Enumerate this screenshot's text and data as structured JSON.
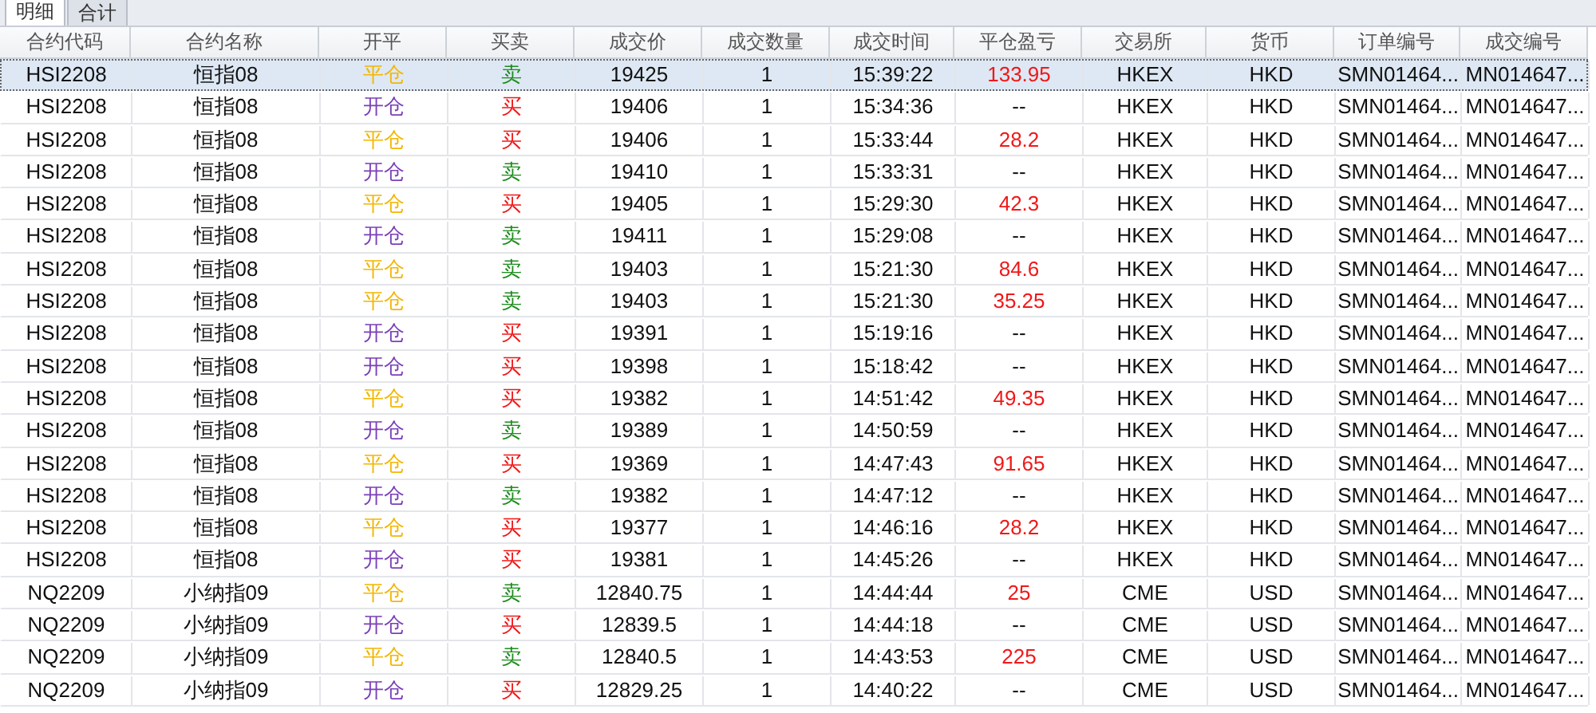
{
  "tabs": [
    {
      "label": "明细",
      "selected": true
    },
    {
      "label": "合计",
      "selected": false
    }
  ],
  "table": {
    "columns": [
      "合约代码",
      "合约名称",
      "开平",
      "买卖",
      "成交价",
      "成交数量",
      "成交时间",
      "平仓盈亏",
      "交易所",
      "货币",
      "订单编号",
      "成交编号"
    ],
    "rows": [
      {
        "selected": true,
        "cells": [
          "HSI2208",
          "恒指08",
          {
            "text": "平仓",
            "color": "#f2b705"
          },
          {
            "text": "卖",
            "color": "#1e8c1e"
          },
          "19425",
          "1",
          "15:39:22",
          {
            "text": "133.95",
            "color": "#f01818"
          },
          "HKEX",
          "HKD",
          "SMN01464...",
          "MN014647..."
        ]
      },
      {
        "selected": false,
        "cells": [
          "HSI2208",
          "恒指08",
          {
            "text": "开仓",
            "color": "#7b3fb8"
          },
          {
            "text": "买",
            "color": "#f01818"
          },
          "19406",
          "1",
          "15:34:36",
          {
            "text": "--",
            "color": "#111111"
          },
          "HKEX",
          "HKD",
          "SMN01464...",
          "MN014647..."
        ]
      },
      {
        "selected": false,
        "cells": [
          "HSI2208",
          "恒指08",
          {
            "text": "平仓",
            "color": "#f2b705"
          },
          {
            "text": "买",
            "color": "#f01818"
          },
          "19406",
          "1",
          "15:33:44",
          {
            "text": "28.2",
            "color": "#f01818"
          },
          "HKEX",
          "HKD",
          "SMN01464...",
          "MN014647..."
        ]
      },
      {
        "selected": false,
        "cells": [
          "HSI2208",
          "恒指08",
          {
            "text": "开仓",
            "color": "#7b3fb8"
          },
          {
            "text": "卖",
            "color": "#1e8c1e"
          },
          "19410",
          "1",
          "15:33:31",
          {
            "text": "--",
            "color": "#111111"
          },
          "HKEX",
          "HKD",
          "SMN01464...",
          "MN014647..."
        ]
      },
      {
        "selected": false,
        "cells": [
          "HSI2208",
          "恒指08",
          {
            "text": "平仓",
            "color": "#f2b705"
          },
          {
            "text": "买",
            "color": "#f01818"
          },
          "19405",
          "1",
          "15:29:30",
          {
            "text": "42.3",
            "color": "#f01818"
          },
          "HKEX",
          "HKD",
          "SMN01464...",
          "MN014647..."
        ]
      },
      {
        "selected": false,
        "cells": [
          "HSI2208",
          "恒指08",
          {
            "text": "开仓",
            "color": "#7b3fb8"
          },
          {
            "text": "卖",
            "color": "#1e8c1e"
          },
          "19411",
          "1",
          "15:29:08",
          {
            "text": "--",
            "color": "#111111"
          },
          "HKEX",
          "HKD",
          "SMN01464...",
          "MN014647..."
        ]
      },
      {
        "selected": false,
        "cells": [
          "HSI2208",
          "恒指08",
          {
            "text": "平仓",
            "color": "#f2b705"
          },
          {
            "text": "卖",
            "color": "#1e8c1e"
          },
          "19403",
          "1",
          "15:21:30",
          {
            "text": "84.6",
            "color": "#f01818"
          },
          "HKEX",
          "HKD",
          "SMN01464...",
          "MN014647..."
        ]
      },
      {
        "selected": false,
        "cells": [
          "HSI2208",
          "恒指08",
          {
            "text": "平仓",
            "color": "#f2b705"
          },
          {
            "text": "卖",
            "color": "#1e8c1e"
          },
          "19403",
          "1",
          "15:21:30",
          {
            "text": "35.25",
            "color": "#f01818"
          },
          "HKEX",
          "HKD",
          "SMN01464...",
          "MN014647..."
        ]
      },
      {
        "selected": false,
        "cells": [
          "HSI2208",
          "恒指08",
          {
            "text": "开仓",
            "color": "#7b3fb8"
          },
          {
            "text": "买",
            "color": "#f01818"
          },
          "19391",
          "1",
          "15:19:16",
          {
            "text": "--",
            "color": "#111111"
          },
          "HKEX",
          "HKD",
          "SMN01464...",
          "MN014647..."
        ]
      },
      {
        "selected": false,
        "cells": [
          "HSI2208",
          "恒指08",
          {
            "text": "开仓",
            "color": "#7b3fb8"
          },
          {
            "text": "买",
            "color": "#f01818"
          },
          "19398",
          "1",
          "15:18:42",
          {
            "text": "--",
            "color": "#111111"
          },
          "HKEX",
          "HKD",
          "SMN01464...",
          "MN014647..."
        ]
      },
      {
        "selected": false,
        "cells": [
          "HSI2208",
          "恒指08",
          {
            "text": "平仓",
            "color": "#f2b705"
          },
          {
            "text": "买",
            "color": "#f01818"
          },
          "19382",
          "1",
          "14:51:42",
          {
            "text": "49.35",
            "color": "#f01818"
          },
          "HKEX",
          "HKD",
          "SMN01464...",
          "MN014647..."
        ]
      },
      {
        "selected": false,
        "cells": [
          "HSI2208",
          "恒指08",
          {
            "text": "开仓",
            "color": "#7b3fb8"
          },
          {
            "text": "卖",
            "color": "#1e8c1e"
          },
          "19389",
          "1",
          "14:50:59",
          {
            "text": "--",
            "color": "#111111"
          },
          "HKEX",
          "HKD",
          "SMN01464...",
          "MN014647..."
        ]
      },
      {
        "selected": false,
        "cells": [
          "HSI2208",
          "恒指08",
          {
            "text": "平仓",
            "color": "#f2b705"
          },
          {
            "text": "买",
            "color": "#f01818"
          },
          "19369",
          "1",
          "14:47:43",
          {
            "text": "91.65",
            "color": "#f01818"
          },
          "HKEX",
          "HKD",
          "SMN01464...",
          "MN014647..."
        ]
      },
      {
        "selected": false,
        "cells": [
          "HSI2208",
          "恒指08",
          {
            "text": "开仓",
            "color": "#7b3fb8"
          },
          {
            "text": "卖",
            "color": "#1e8c1e"
          },
          "19382",
          "1",
          "14:47:12",
          {
            "text": "--",
            "color": "#111111"
          },
          "HKEX",
          "HKD",
          "SMN01464...",
          "MN014647..."
        ]
      },
      {
        "selected": false,
        "cells": [
          "HSI2208",
          "恒指08",
          {
            "text": "平仓",
            "color": "#f2b705"
          },
          {
            "text": "买",
            "color": "#f01818"
          },
          "19377",
          "1",
          "14:46:16",
          {
            "text": "28.2",
            "color": "#f01818"
          },
          "HKEX",
          "HKD",
          "SMN01464...",
          "MN014647..."
        ]
      },
      {
        "selected": false,
        "cells": [
          "HSI2208",
          "恒指08",
          {
            "text": "开仓",
            "color": "#7b3fb8"
          },
          {
            "text": "买",
            "color": "#f01818"
          },
          "19381",
          "1",
          "14:45:26",
          {
            "text": "--",
            "color": "#111111"
          },
          "HKEX",
          "HKD",
          "SMN01464...",
          "MN014647..."
        ]
      },
      {
        "selected": false,
        "cells": [
          "NQ2209",
          "小纳指09",
          {
            "text": "平仓",
            "color": "#f2b705"
          },
          {
            "text": "卖",
            "color": "#1e8c1e"
          },
          "12840.75",
          "1",
          "14:44:44",
          {
            "text": "25",
            "color": "#f01818"
          },
          "CME",
          "USD",
          "SMN01464...",
          "MN014647..."
        ]
      },
      {
        "selected": false,
        "cells": [
          "NQ2209",
          "小纳指09",
          {
            "text": "开仓",
            "color": "#7b3fb8"
          },
          {
            "text": "买",
            "color": "#f01818"
          },
          "12839.5",
          "1",
          "14:44:18",
          {
            "text": "--",
            "color": "#111111"
          },
          "CME",
          "USD",
          "SMN01464...",
          "MN014647..."
        ]
      },
      {
        "selected": false,
        "cells": [
          "NQ2209",
          "小纳指09",
          {
            "text": "平仓",
            "color": "#f2b705"
          },
          {
            "text": "卖",
            "color": "#1e8c1e"
          },
          "12840.5",
          "1",
          "14:43:53",
          {
            "text": "225",
            "color": "#f01818"
          },
          "CME",
          "USD",
          "SMN01464...",
          "MN014647..."
        ]
      },
      {
        "selected": false,
        "cells": [
          "NQ2209",
          "小纳指09",
          {
            "text": "开仓",
            "color": "#7b3fb8"
          },
          {
            "text": "买",
            "color": "#f01818"
          },
          "12829.25",
          "1",
          "14:40:22",
          {
            "text": "--",
            "color": "#111111"
          },
          "CME",
          "USD",
          "SMN01464...",
          "MN014647..."
        ]
      }
    ]
  }
}
